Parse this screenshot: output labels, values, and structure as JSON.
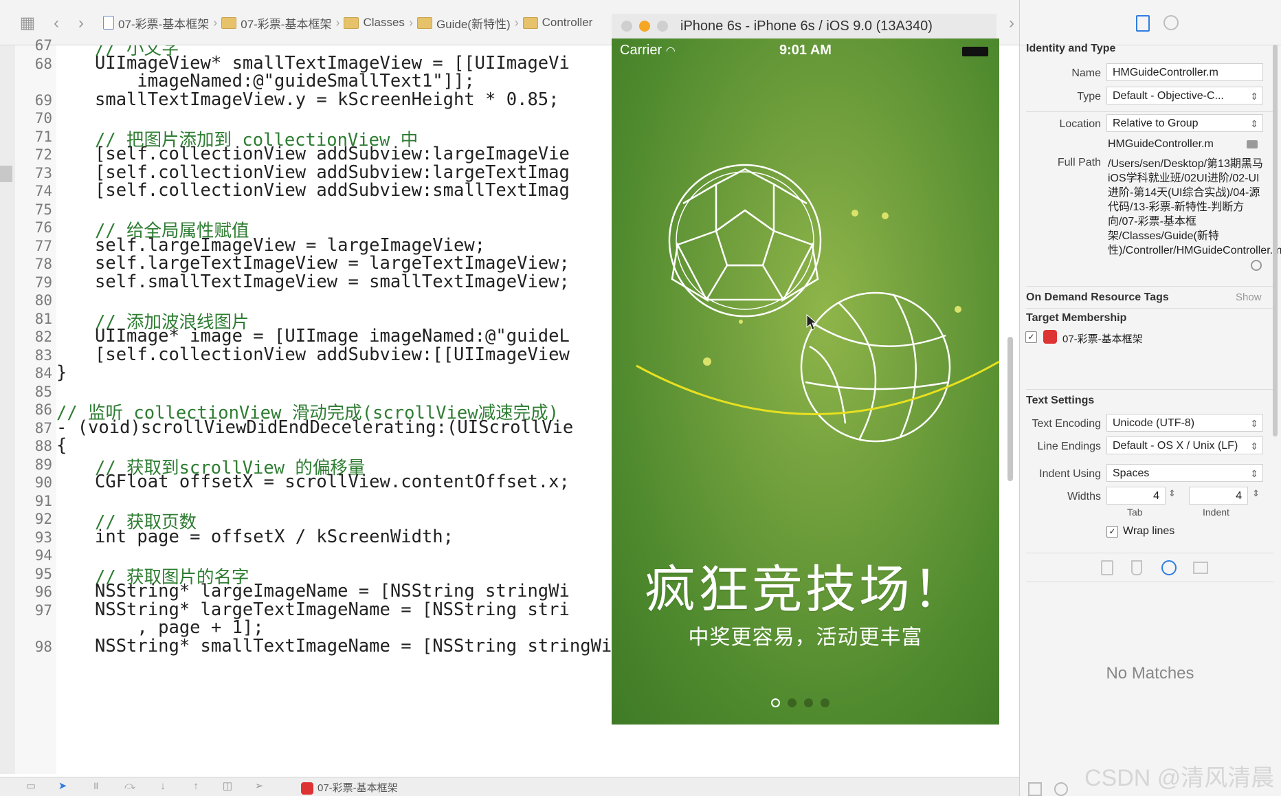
{
  "breadcrumbs": [
    {
      "label": "07-彩票-基本框架",
      "kind": "project"
    },
    {
      "label": "07-彩票-基本框架",
      "kind": "folder"
    },
    {
      "label": "Classes",
      "kind": "folder"
    },
    {
      "label": "Guide(新特性)",
      "kind": "folder"
    },
    {
      "label": "Controller",
      "kind": "folder"
    }
  ],
  "editor": {
    "lines": [
      {
        "num": "67",
        "text": "// 小文字",
        "cut": true
      },
      {
        "num": "68",
        "text": "UIImageView* smallTextImageView = [[UIImageVi"
      },
      {
        "num": "",
        "text": "    imageNamed:@\"guideSmallText1\"]];"
      },
      {
        "num": "69",
        "text": "smallTextImageView.y = kScreenHeight * 0.85;"
      },
      {
        "num": "70",
        "text": ""
      },
      {
        "num": "71",
        "text": "// 把图片添加到 collectionView 中"
      },
      {
        "num": "72",
        "text": "[self.collectionView addSubview:largeImageVie"
      },
      {
        "num": "73",
        "text": "[self.collectionView addSubview:largeTextImag"
      },
      {
        "num": "74",
        "text": "[self.collectionView addSubview:smallTextImag"
      },
      {
        "num": "75",
        "text": ""
      },
      {
        "num": "76",
        "text": "// 给全局属性赋值"
      },
      {
        "num": "77",
        "text": "self.largeImageView = largeImageView;"
      },
      {
        "num": "78",
        "text": "self.largeTextImageView = largeTextImageView;"
      },
      {
        "num": "79",
        "text": "self.smallTextImageView = smallTextImageView;"
      },
      {
        "num": "80",
        "text": ""
      },
      {
        "num": "81",
        "text": "// 添加波浪线图片"
      },
      {
        "num": "82",
        "text": "UIImage* image = [UIImage imageNamed:@\"guideL"
      },
      {
        "num": "83",
        "text": "[self.collectionView addSubview:[[UIImageView"
      },
      {
        "num": "84",
        "text": "}"
      },
      {
        "num": "85",
        "text": ""
      },
      {
        "num": "86",
        "text": "// 监听 collectionView 滑动完成(scrollView减速完成)"
      },
      {
        "num": "87",
        "text": "- (void)scrollViewDidEndDecelerating:(UIScrollVie"
      },
      {
        "num": "88",
        "text": "{"
      },
      {
        "num": "89",
        "text": "// 获取到scrollView 的偏移量"
      },
      {
        "num": "90",
        "text": "CGFloat offsetX = scrollView.contentOffset.x;"
      },
      {
        "num": "91",
        "text": ""
      },
      {
        "num": "92",
        "text": "// 获取页数"
      },
      {
        "num": "93",
        "text": "int page = offsetX / kScreenWidth;"
      },
      {
        "num": "94",
        "text": ""
      },
      {
        "num": "95",
        "text": "// 获取图片的名字"
      },
      {
        "num": "96",
        "text": "NSString* largeImageName = [NSString stringWi"
      },
      {
        "num": "97",
        "text": "NSString* largeTextImageName = [NSString stri"
      },
      {
        "num": "",
        "text": "    , page + 1];"
      },
      {
        "num": "98",
        "text": "NSString* smallTextImageName = [NSString stringWithFormat:@\"guideSmallText%zd\""
      }
    ]
  },
  "simulator": {
    "title": "iPhone 6s - iPhone 6s / iOS 9.0 (13A340)",
    "carrier": "Carrier",
    "time": "9:01 AM",
    "headline": "疯狂竞技场！",
    "subline": "中奖更容易，活动更丰富",
    "page_count": 4,
    "current_page": 1,
    "line_color": "#e8e020"
  },
  "inspector": {
    "identity_title": "Identity and Type",
    "name_label": "Name",
    "name_value": "HMGuideController.m",
    "type_label": "Type",
    "type_value": "Default - Objective-C...",
    "location_label": "Location",
    "location_value": "Relative to Group",
    "location_file": "HMGuideController.m",
    "fullpath_label": "Full Path",
    "fullpath_value": "/Users/sen/Desktop/第13期黑马iOS学科就业班/02UI进阶/02-UI进阶-第14天(UI综合实战)/04-源代码/13-彩票-新特性-判断方向/07-彩票-基本框架/Classes/Guide(新特性)/Controller/HMGuideController.m",
    "odr_title": "On Demand Resource Tags",
    "odr_show": "Show",
    "target_title": "Target Membership",
    "target_name": "07-彩票-基本框架",
    "text_settings_title": "Text Settings",
    "encoding_label": "Text Encoding",
    "encoding_value": "Unicode (UTF-8)",
    "line_endings_label": "Line Endings",
    "line_endings_value": "Default - OS X / Unix (LF)",
    "indent_using_label": "Indent Using",
    "indent_using_value": "Spaces",
    "widths_label": "Widths",
    "tab_value": "4",
    "indent_value": "4",
    "tab_label": "Tab",
    "indent_label": "Indent",
    "wrap_label": "Wrap lines",
    "no_matches": "No Matches"
  },
  "debugbar": {
    "target": "07-彩票-基本框架"
  },
  "watermark": "CSDN @清风清晨"
}
